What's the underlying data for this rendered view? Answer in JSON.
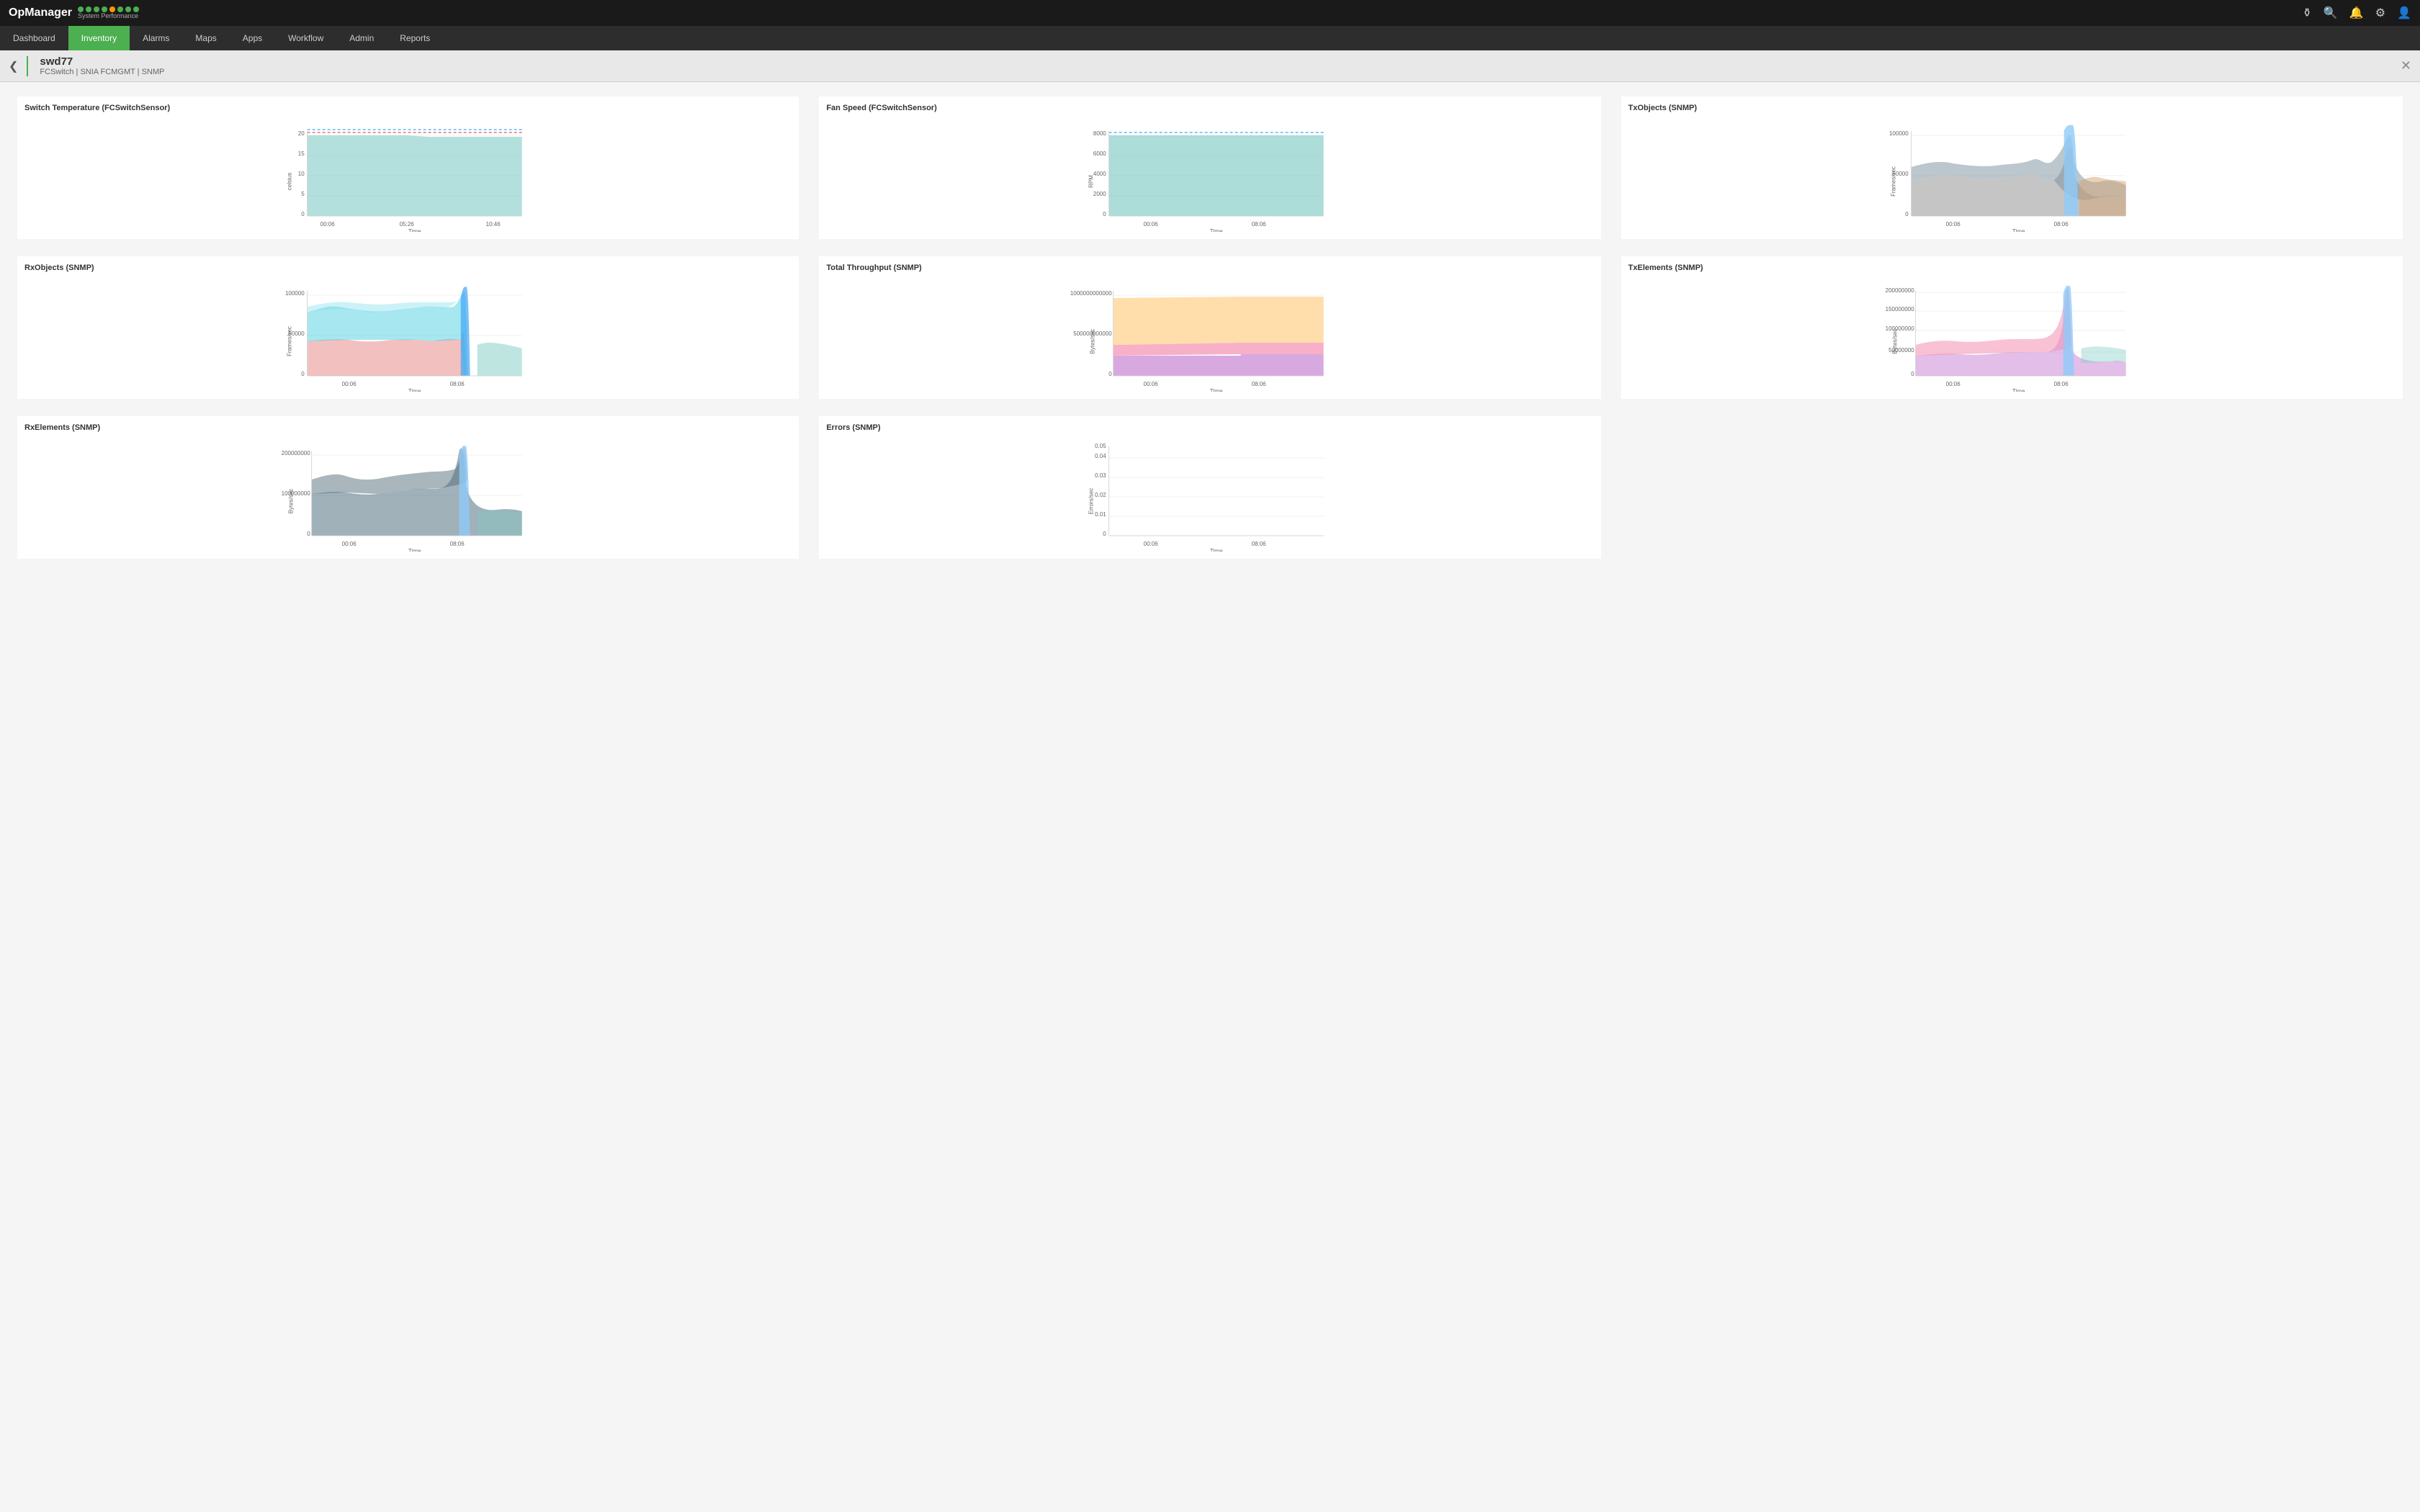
{
  "topbar": {
    "logo": "OpManager",
    "syslabel": "System Performance",
    "icons": [
      "notifications-icon",
      "search-icon",
      "bell-icon",
      "settings-icon",
      "user-icon"
    ]
  },
  "nav": {
    "items": [
      {
        "label": "Dashboard",
        "active": false
      },
      {
        "label": "Inventory",
        "active": true
      },
      {
        "label": "Alarms",
        "active": false
      },
      {
        "label": "Maps",
        "active": false
      },
      {
        "label": "Apps",
        "active": false
      },
      {
        "label": "Workflow",
        "active": false
      },
      {
        "label": "Admin",
        "active": false
      },
      {
        "label": "Reports",
        "active": false
      }
    ]
  },
  "breadcrumb": {
    "title": "swd77",
    "subtitle": "FCSwitch | SNIA FCMGMT | SNMP"
  },
  "charts": [
    {
      "title": "Switch Temperature (FCSwitchSensor)",
      "ytitle": "celsius",
      "xtitle": "Time",
      "xlabels": [
        "00:06",
        "05:26",
        "10:46"
      ],
      "ylabels": [
        "0",
        "5",
        "10",
        "15",
        "20"
      ],
      "type": "area_flat"
    },
    {
      "title": "Fan Speed (FCSwitchSensor)",
      "ytitle": "RPM",
      "xtitle": "Time",
      "xlabels": [
        "00:06",
        "08:06"
      ],
      "ylabels": [
        "0",
        "2000",
        "4000",
        "6000",
        "8000"
      ],
      "type": "area_flat_fan"
    },
    {
      "title": "TxObjects (SNMP)",
      "ytitle": "Frames/sec",
      "xtitle": "Time",
      "xlabels": [
        "00:06",
        "08:06"
      ],
      "ylabels": [
        "0",
        "50000",
        "100000"
      ],
      "type": "area_multi_tx"
    },
    {
      "title": "RxObjects (SNMP)",
      "ytitle": "Frames/sec",
      "xtitle": "Time",
      "xlabels": [
        "00:06",
        "08:06"
      ],
      "ylabels": [
        "0",
        "50000",
        "100000"
      ],
      "type": "area_multi_rx"
    },
    {
      "title": "Total Throughput (SNMP)",
      "ytitle": "Bytes/sec",
      "xtitle": "Time",
      "xlabels": [
        "00:06",
        "08:06"
      ],
      "ylabels": [
        "0",
        "500000000000",
        "1000000000000"
      ],
      "type": "area_throughput"
    },
    {
      "title": "TxElements (SNMP)",
      "ytitle": "Bytes/sec",
      "xtitle": "Time",
      "xlabels": [
        "00:06",
        "08:06"
      ],
      "ylabels": [
        "0",
        "50000000",
        "100000000",
        "150000000",
        "200000000"
      ],
      "type": "area_multi_txel"
    },
    {
      "title": "RxElements (SNMP)",
      "ytitle": "Bytes/sec",
      "xtitle": "Time",
      "xlabels": [
        "00:06",
        "08:06"
      ],
      "ylabels": [
        "0",
        "100000000",
        "200000000"
      ],
      "type": "area_multi_rxel"
    },
    {
      "title": "Errors (SNMP)",
      "ytitle": "Errors/sec",
      "xtitle": "Time",
      "xlabels": [
        "00:06",
        "08:06"
      ],
      "ylabels": [
        "0",
        "0.01",
        "0.02",
        "0.03",
        "0.04",
        "0.05"
      ],
      "type": "area_errors"
    }
  ]
}
